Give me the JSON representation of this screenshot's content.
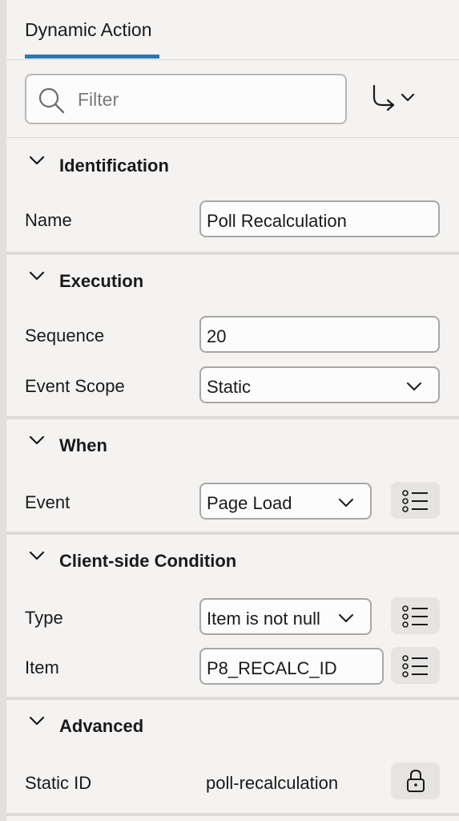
{
  "tabs": {
    "active": "Dynamic Action"
  },
  "filter": {
    "placeholder": "Filter"
  },
  "sections": {
    "identification": {
      "title": "Identification",
      "name_label": "Name",
      "name_value": "Poll Recalculation"
    },
    "execution": {
      "title": "Execution",
      "sequence_label": "Sequence",
      "sequence_value": "20",
      "scope_label": "Event Scope",
      "scope_value": "Static"
    },
    "when": {
      "title": "When",
      "event_label": "Event",
      "event_value": "Page Load"
    },
    "condition": {
      "title": "Client-side Condition",
      "type_label": "Type",
      "type_value": "Item is not null",
      "item_label": "Item",
      "item_value": "P8_RECALC_ID"
    },
    "advanced": {
      "title": "Advanced",
      "static_id_label": "Static ID",
      "static_id_value": "poll-recalculation"
    }
  },
  "icons": {
    "filter": "search-icon",
    "goto": "goto-arrow-icon",
    "chevron": "chevron-down-icon",
    "lov": "list-icon",
    "lock": "lock-icon"
  },
  "colors": {
    "accent": "#2a7ab0",
    "background": "#f4f3f2"
  }
}
